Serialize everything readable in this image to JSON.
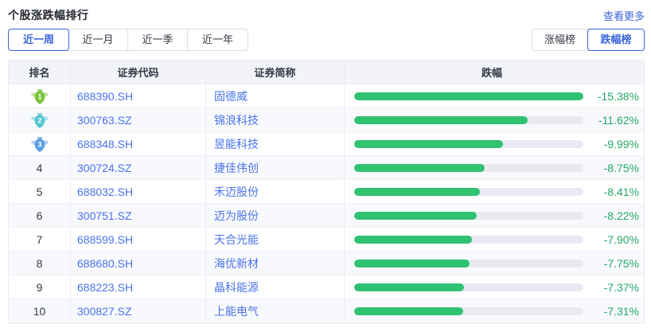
{
  "widget": {
    "title": "个股涨跌幅排行",
    "more_link": "查看更多"
  },
  "period_tabs": {
    "items": [
      "近一周",
      "近一月",
      "近一季",
      "近一年"
    ],
    "active_index": 0
  },
  "board_toggle": {
    "items": [
      "涨幅榜",
      "跌幅榜"
    ],
    "active_index": 1
  },
  "table": {
    "columns": [
      "排名",
      "证券代码",
      "证券简称",
      "跌幅"
    ],
    "rows": [
      {
        "rank": 1,
        "code": "688390.SH",
        "name": "固德威",
        "change_pct": -15.38,
        "change_label": "-15.38%"
      },
      {
        "rank": 2,
        "code": "300763.SZ",
        "name": "锦浪科技",
        "change_pct": -11.62,
        "change_label": "-11.62%"
      },
      {
        "rank": 3,
        "code": "688348.SH",
        "name": "昱能科技",
        "change_pct": -9.99,
        "change_label": "-9.99%"
      },
      {
        "rank": 4,
        "code": "300724.SZ",
        "name": "捷佳伟创",
        "change_pct": -8.75,
        "change_label": "-8.75%"
      },
      {
        "rank": 5,
        "code": "688032.SH",
        "name": "禾迈股份",
        "change_pct": -8.41,
        "change_label": "-8.41%"
      },
      {
        "rank": 6,
        "code": "300751.SZ",
        "name": "迈为股份",
        "change_pct": -8.22,
        "change_label": "-8.22%"
      },
      {
        "rank": 7,
        "code": "688599.SH",
        "name": "天合光能",
        "change_pct": -7.9,
        "change_label": "-7.90%"
      },
      {
        "rank": 8,
        "code": "688680.SH",
        "name": "海优新材",
        "change_pct": -7.75,
        "change_label": "-7.75%"
      },
      {
        "rank": 9,
        "code": "688223.SH",
        "name": "晶科能源",
        "change_pct": -7.37,
        "change_label": "-7.37%"
      },
      {
        "rank": 10,
        "code": "300827.SZ",
        "name": "上能电气",
        "change_pct": -7.31,
        "change_label": "-7.31%"
      }
    ]
  },
  "chart_data": {
    "type": "bar",
    "title": "个股涨跌幅排行 - 近一周 跌幅榜",
    "categories": [
      "固德威",
      "锦浪科技",
      "昱能科技",
      "捷佳伟创",
      "禾迈股份",
      "迈为股份",
      "天合光能",
      "海优新材",
      "晶科能源",
      "上能电气"
    ],
    "values": [
      -15.38,
      -11.62,
      -9.99,
      -8.75,
      -8.41,
      -8.22,
      -7.9,
      -7.75,
      -7.37,
      -7.31
    ],
    "xlabel": "",
    "ylabel": "跌幅 (%)",
    "xlim": [
      -15.38,
      0
    ],
    "legend": false,
    "grid": false
  },
  "colors": {
    "accent_blue": "#3a66dd",
    "stock_blue": "#4a73e8",
    "bar_green": "#2fc271",
    "pct_green": "#22a767",
    "bar_track": "#e9e9f2",
    "rank_badge_1": "#7cc13a",
    "rank_badge_2": "#56c5d0",
    "rank_badge_3": "#5b9de2"
  }
}
